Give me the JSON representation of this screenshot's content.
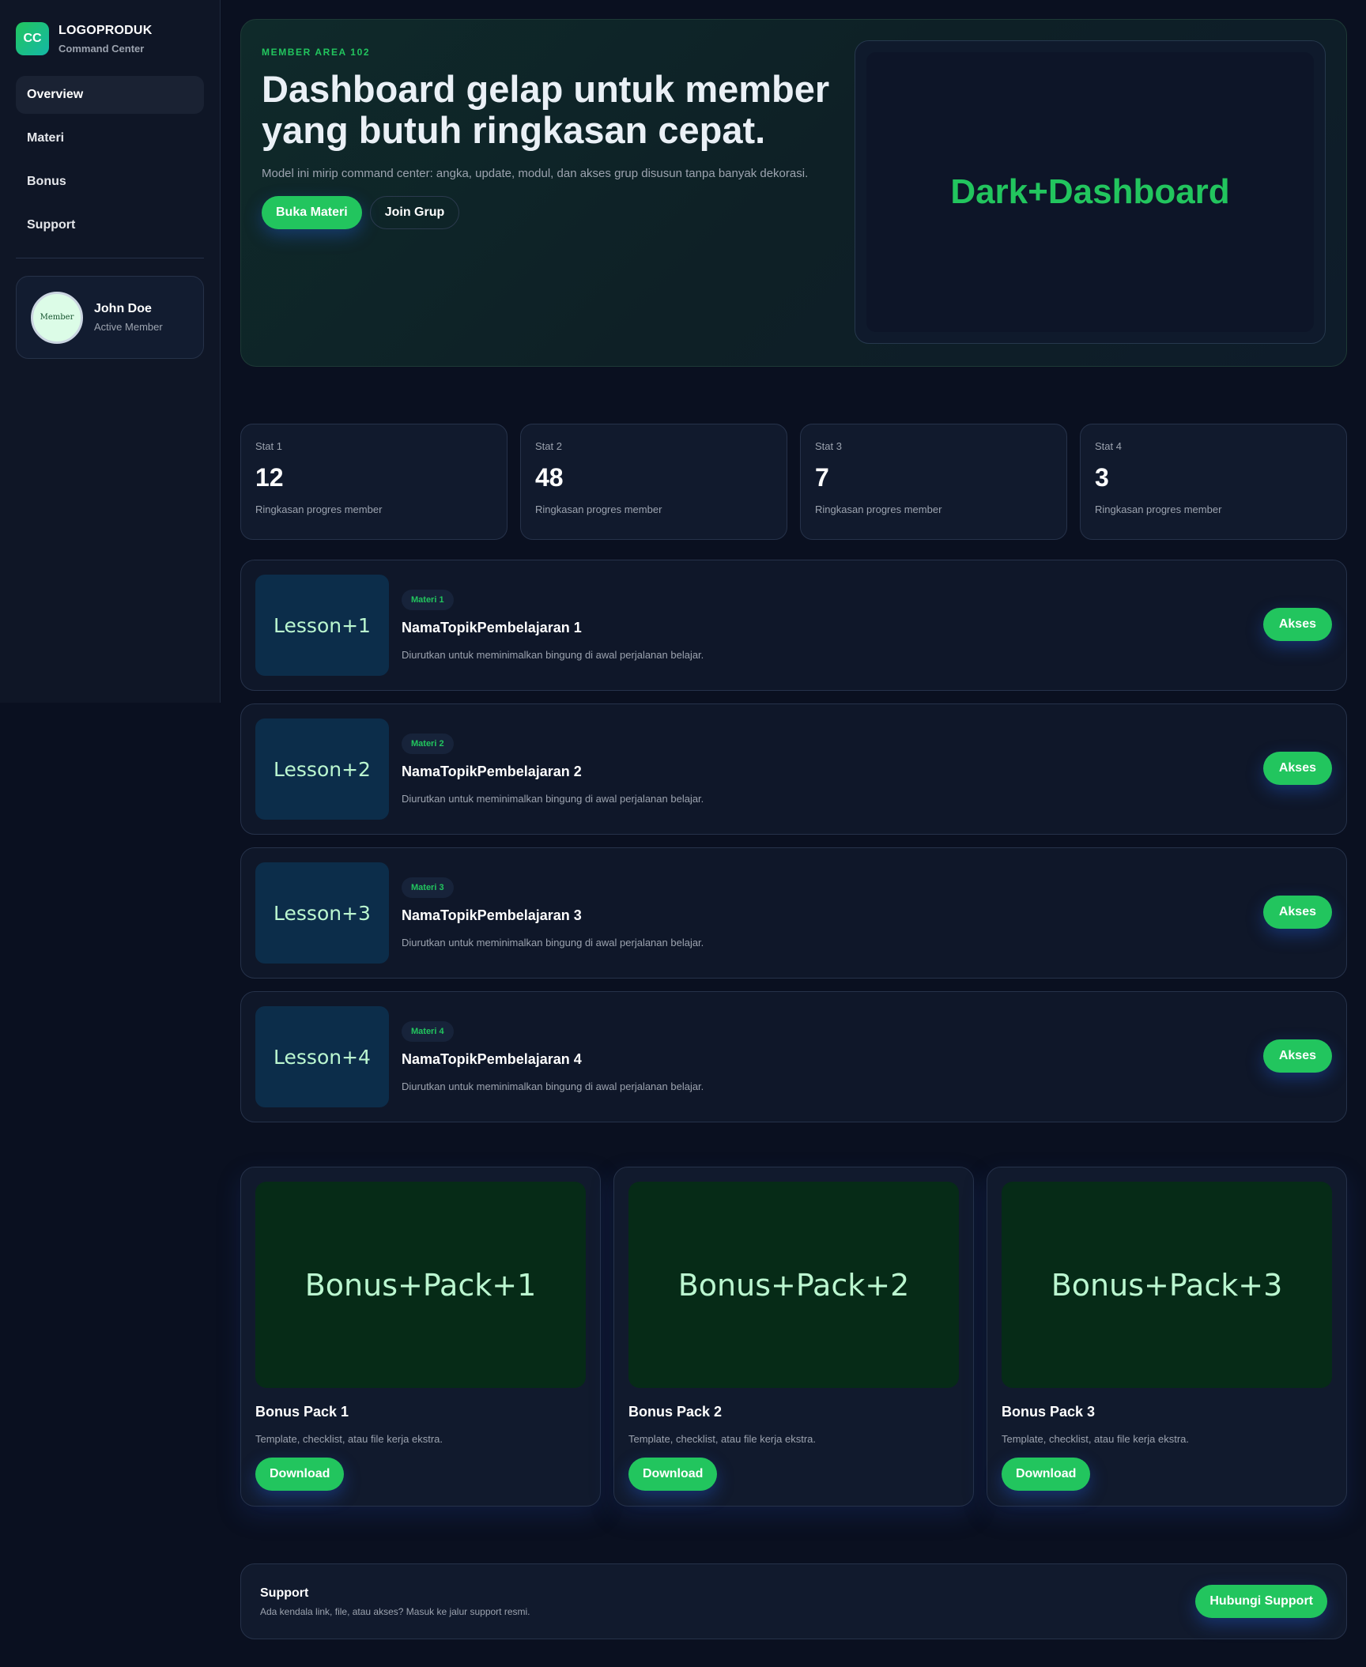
{
  "brand": {
    "badge": "CC",
    "name": "LOGOPRODUK",
    "subtitle": "Command Center"
  },
  "sidebar": {
    "items": [
      {
        "label": "Overview",
        "active": true
      },
      {
        "label": "Materi",
        "active": false
      },
      {
        "label": "Bonus",
        "active": false
      },
      {
        "label": "Support",
        "active": false
      }
    ]
  },
  "profile": {
    "avatar_text": "Member",
    "name": "John Doe",
    "role": "Active Member"
  },
  "hero": {
    "eyebrow": "MEMBER AREA 102",
    "title": "Dashboard gelap untuk member yang butuh ringkasan cepat.",
    "description": "Model ini mirip command center: angka, update, modul, dan akses grup disusun tanpa banyak dekorasi.",
    "primary_button": "Buka Materi",
    "secondary_button": "Join Grup",
    "panel_text": "Dark+Dashboard"
  },
  "stats": [
    {
      "label": "Stat 1",
      "value": "12",
      "desc": "Ringkasan progres member"
    },
    {
      "label": "Stat 2",
      "value": "48",
      "desc": "Ringkasan progres member"
    },
    {
      "label": "Stat 3",
      "value": "7",
      "desc": "Ringkasan progres member"
    },
    {
      "label": "Stat 4",
      "value": "3",
      "desc": "Ringkasan progres member"
    }
  ],
  "lessons": [
    {
      "thumb": "Lesson+1",
      "tag": "Materi 1",
      "title": "NamaTopikPembelajaran 1",
      "desc": "Diurutkan untuk meminimalkan bingung di awal perjalanan belajar.",
      "button": "Akses"
    },
    {
      "thumb": "Lesson+2",
      "tag": "Materi 2",
      "title": "NamaTopikPembelajaran 2",
      "desc": "Diurutkan untuk meminimalkan bingung di awal perjalanan belajar.",
      "button": "Akses"
    },
    {
      "thumb": "Lesson+3",
      "tag": "Materi 3",
      "title": "NamaTopikPembelajaran 3",
      "desc": "Diurutkan untuk meminimalkan bingung di awal perjalanan belajar.",
      "button": "Akses"
    },
    {
      "thumb": "Lesson+4",
      "tag": "Materi 4",
      "title": "NamaTopikPembelajaran 4",
      "desc": "Diurutkan untuk meminimalkan bingung di awal perjalanan belajar.",
      "button": "Akses"
    }
  ],
  "bonuses": [
    {
      "thumb": "Bonus+Pack+1",
      "title": "Bonus Pack 1",
      "desc": "Template, checklist, atau file kerja ekstra.",
      "button": "Download"
    },
    {
      "thumb": "Bonus+Pack+2",
      "title": "Bonus Pack 2",
      "desc": "Template, checklist, atau file kerja ekstra.",
      "button": "Download"
    },
    {
      "thumb": "Bonus+Pack+3",
      "title": "Bonus Pack 3",
      "desc": "Template, checklist, atau file kerja ekstra.",
      "button": "Download"
    }
  ],
  "support": {
    "title": "Support",
    "description": "Ada kendala link, file, atau akses? Masuk ke jalur support resmi.",
    "button": "Hubungi Support"
  },
  "colors": {
    "accent": "#22c55e",
    "background": "#0a1020",
    "card": "#111a2d"
  }
}
